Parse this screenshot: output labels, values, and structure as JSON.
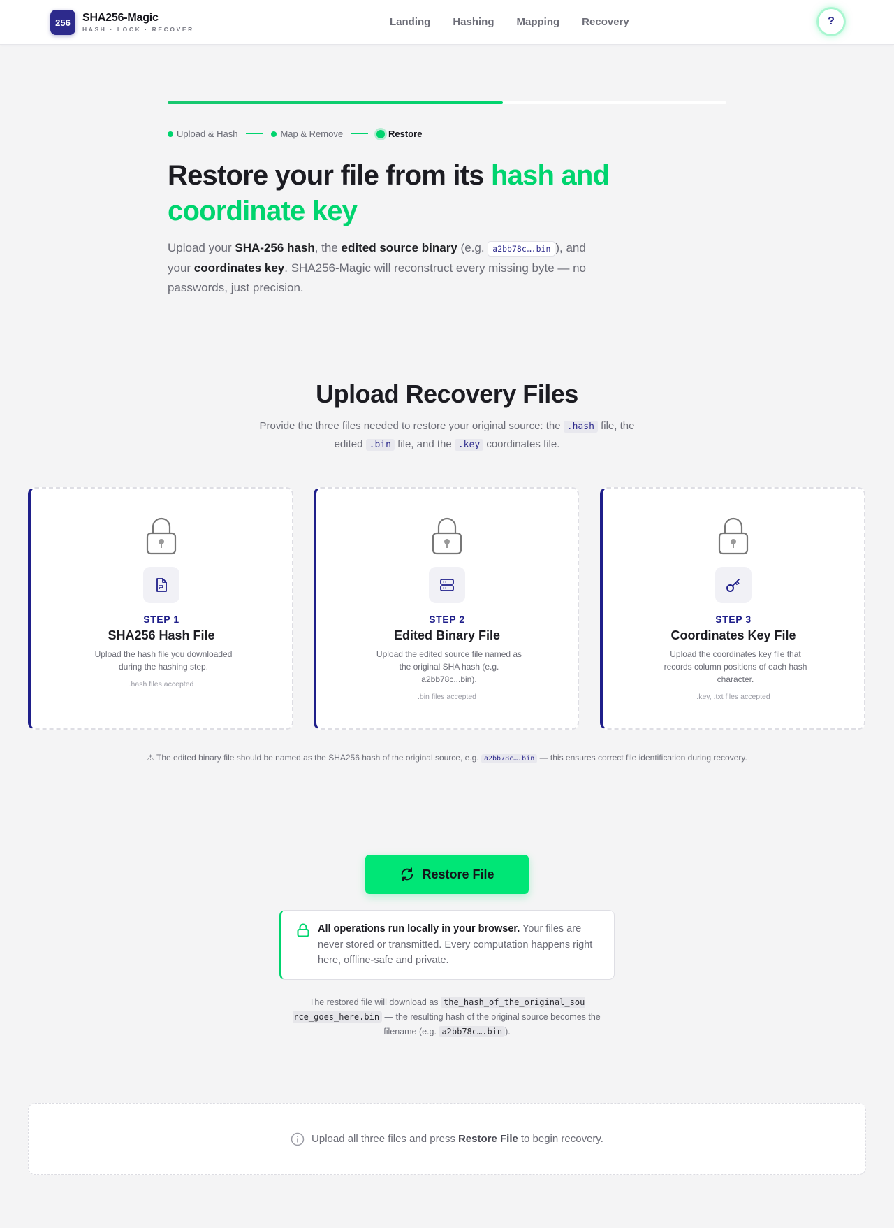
{
  "header": {
    "brand_badge": "256",
    "brand_name": "SHA256-Magic",
    "brand_tagline": "HASH · LOCK · RECOVER",
    "nav": [
      "Landing",
      "Hashing",
      "Mapping",
      "Recovery"
    ],
    "help_label": "?"
  },
  "progress": {
    "fraction": 0.6,
    "steps": [
      "Upload & Hash",
      "Map & Remove",
      "Restore"
    ],
    "active_step": "Restore"
  },
  "hero": {
    "title_plain": "Restore your file from its ",
    "title_accent": "hash and coordinate key",
    "lead": {
      "t1": "Upload your ",
      "b1": "SHA-256 hash",
      "t2": ", the ",
      "b2": "edited source binary",
      "t3": " (e.g. ",
      "code": "a2bb78c….bin",
      "t4": "), and your ",
      "b3": "coordinates key",
      "t5": ". SHA256-Magic will reconstruct every missing byte — no passwords, just precision."
    }
  },
  "upload": {
    "title": "Upload Recovery Files",
    "sub": {
      "t1": "Provide the three files needed to restore your original source: the ",
      "c1": ".hash",
      "t2": " file, the edited ",
      "c2": ".bin",
      "t3": " file, and the ",
      "c3": ".key",
      "t4": " coordinates file."
    },
    "cards": [
      {
        "step": "STEP 1",
        "title": "SHA256 Hash File",
        "desc": "Upload the hash file you downloaded during the hashing step.",
        "accept": ".hash files accepted",
        "icon": "file-icon"
      },
      {
        "step": "STEP 2",
        "title": "Edited Binary File",
        "desc": "Upload the edited source file named as the original SHA hash (e.g. a2bb78c...bin).",
        "accept": ".bin files accepted",
        "icon": "server-icon"
      },
      {
        "step": "STEP 3",
        "title": "Coordinates Key File",
        "desc": "Upload the coordinates key file that records column positions of each hash character.",
        "accept": ".key, .txt files accepted",
        "icon": "key-icon"
      }
    ],
    "warning": {
      "t1": "⚠ The edited binary file should be named as the SHA256 hash of the original source, e.g. ",
      "code": "a2bb78c….bin",
      "t2": " — this ensures correct file identification during recovery."
    }
  },
  "restore": {
    "button_label": "Restore File",
    "privacy_bold": "All operations run locally in your browser.",
    "privacy_text": " Your files are never stored or transmitted. Every computation happens right here, offline-safe and private.",
    "download_note": {
      "t1": "The restored file will download as ",
      "code1": "the_hash_of_the_original_sou rce_goes_here.bin",
      "t2": " — the resulting hash of the original source becomes the filename (e.g. ",
      "code2": "a2bb78c….bin",
      "t3": ")."
    }
  },
  "status": {
    "t1": "Upload all three files and press",
    "b1": "Restore File",
    "t2": "to begin recovery."
  },
  "colors": {
    "accent": "#00e676",
    "brand": "#2d2a8c",
    "step_blue": "#1f1f8a"
  }
}
